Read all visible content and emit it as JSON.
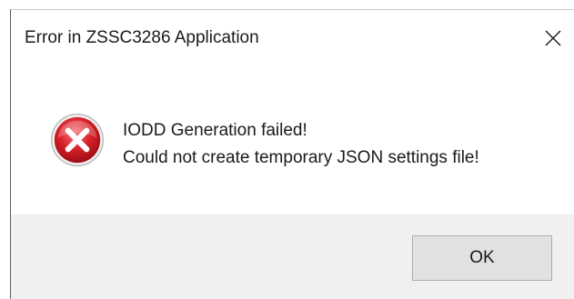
{
  "dialog": {
    "title": "Error in ZSSC3286 Application",
    "close_icon": "close-icon",
    "icon": "error-icon",
    "message_lines": [
      "IODD Generation failed!",
      "Could not create temporary JSON settings file!"
    ],
    "ok_label": "OK"
  },
  "colors": {
    "title_bar": "#ffffff",
    "content": "#ffffff",
    "button_bar": "#f0f0f0",
    "button_face": "#e1e1e1",
    "button_border": "#adadad",
    "error_red": "#d71f28",
    "text": "#1a1a1a"
  }
}
